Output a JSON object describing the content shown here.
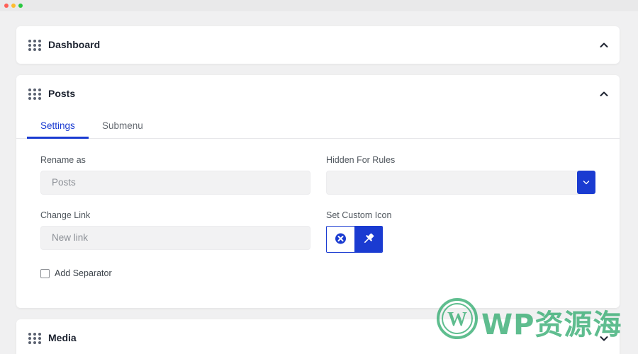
{
  "sections": [
    {
      "title": "Dashboard",
      "expanded": false
    },
    {
      "title": "Posts",
      "expanded": true
    },
    {
      "title": "Media",
      "expanded": false
    }
  ],
  "posts_panel": {
    "tabs": [
      {
        "label": "Settings",
        "active": true
      },
      {
        "label": "Submenu",
        "active": false
      }
    ],
    "rename_label": "Rename as",
    "rename_value": "Posts",
    "hidden_rules_label": "Hidden For Rules",
    "hidden_rules_value": "",
    "change_link_label": "Change Link",
    "change_link_placeholder": "New link",
    "custom_icon_label": "Set Custom Icon",
    "separator_label": "Add Separator",
    "separator_checked": false
  },
  "watermark": {
    "text": "WP资源海"
  },
  "colors": {
    "accent": "#1a3bd1",
    "background": "#f0f0f1",
    "watermark": "#2aa86a"
  }
}
